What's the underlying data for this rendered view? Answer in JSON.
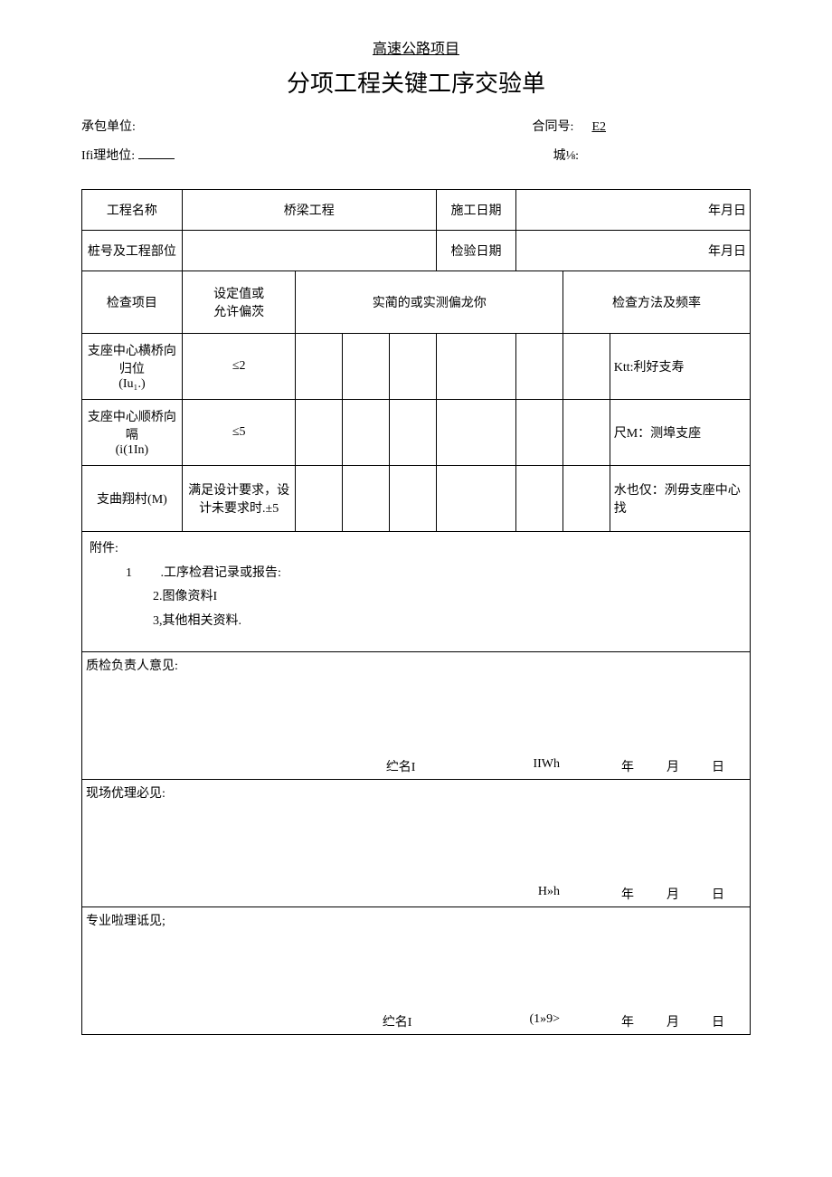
{
  "header": {
    "subtitle": "高速公路项目",
    "title": "分项工程关键工序交验单"
  },
  "meta": {
    "contractor_label": "承包单位:",
    "contract_no_label": "合同号:",
    "contract_no_value": "E2",
    "supervisor_label": "Ifi理地位:",
    "number_label": "城⅛:"
  },
  "table": {
    "project_name_label": "工程名称",
    "project_name_value": "桥梁工程",
    "construct_date_label": "施工日期",
    "construct_date_value": "年月日",
    "stake_label": "桩号及工程部位",
    "inspect_date_label": "检验日期",
    "inspect_date_value": "年月日",
    "col_item": "检查项目",
    "col_setting": "设定值或\n允许偏茨",
    "col_actual": "实蔺的或实测偏龙你",
    "col_method": "检查方法及频率",
    "rows": [
      {
        "item": "支座中心横桥向归位\n(Iu₁.)",
        "setting": "≤2",
        "method": "Ktt:利好支寿"
      },
      {
        "item": "支座中心顺桥向嗝\n(i(1In)",
        "setting": "≤5",
        "method": "尺M：测埠支座"
      },
      {
        "item": "支曲翔村(M)",
        "setting": "满足设计要求，设计未要求时.±5",
        "method": "水也仅：洌毋支座中心找"
      }
    ]
  },
  "attachments": {
    "label": "附件:",
    "items": [
      "1         .工序检君记录或报告:",
      "2.图像资料I",
      "3,其他相关资料."
    ]
  },
  "opinions": [
    {
      "label": "质检负责人意见:",
      "sig_name": "纻名I",
      "sig_id": "IIWh",
      "year": "年",
      "month": "月",
      "day": "日"
    },
    {
      "label": "现场优理必见:",
      "sig_name": "",
      "sig_id": "H»h",
      "year": "年",
      "month": "月",
      "day": "日"
    },
    {
      "label": "专业啦理诋见;",
      "sig_name": "纻名I",
      "sig_id": "(1»9>",
      "year": "年",
      "month": "月",
      "day": "日"
    }
  ]
}
